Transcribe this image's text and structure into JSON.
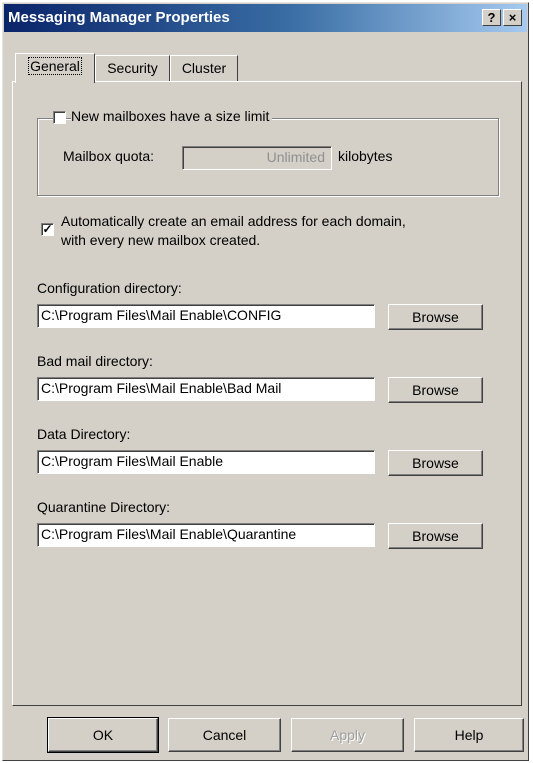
{
  "window": {
    "title": "Messaging Manager Properties",
    "help_button": "?",
    "close_button": "×"
  },
  "tabs": [
    {
      "label": "General",
      "active": true
    },
    {
      "label": "Security",
      "active": false
    },
    {
      "label": "Cluster",
      "active": false
    }
  ],
  "mailbox_limit": {
    "checkbox_label": "New mailboxes have a size limit",
    "checked": false,
    "quota_label": "Mailbox quota:",
    "quota_value": "Unlimited",
    "quota_unit": "kilobytes"
  },
  "auto_email": {
    "line1": "Automatically create an email address for each domain,",
    "line2": "with every new mailbox created.",
    "checked": true,
    "check_glyph": "✓"
  },
  "directories": [
    {
      "label": "Configuration directory:",
      "value": "C:\\Program Files\\Mail Enable\\CONFIG",
      "button": "Browse"
    },
    {
      "label": "Bad mail directory:",
      "value": "C:\\Program Files\\Mail Enable\\Bad Mail",
      "button": "Browse"
    },
    {
      "label": "Data Directory:",
      "value": "C:\\Program Files\\Mail Enable",
      "button": "Browse"
    },
    {
      "label": "Quarantine Directory:",
      "value": "C:\\Program Files\\Mail Enable\\Quarantine",
      "button": "Browse"
    }
  ],
  "footer": {
    "ok": "OK",
    "cancel": "Cancel",
    "apply": "Apply",
    "help": "Help"
  }
}
